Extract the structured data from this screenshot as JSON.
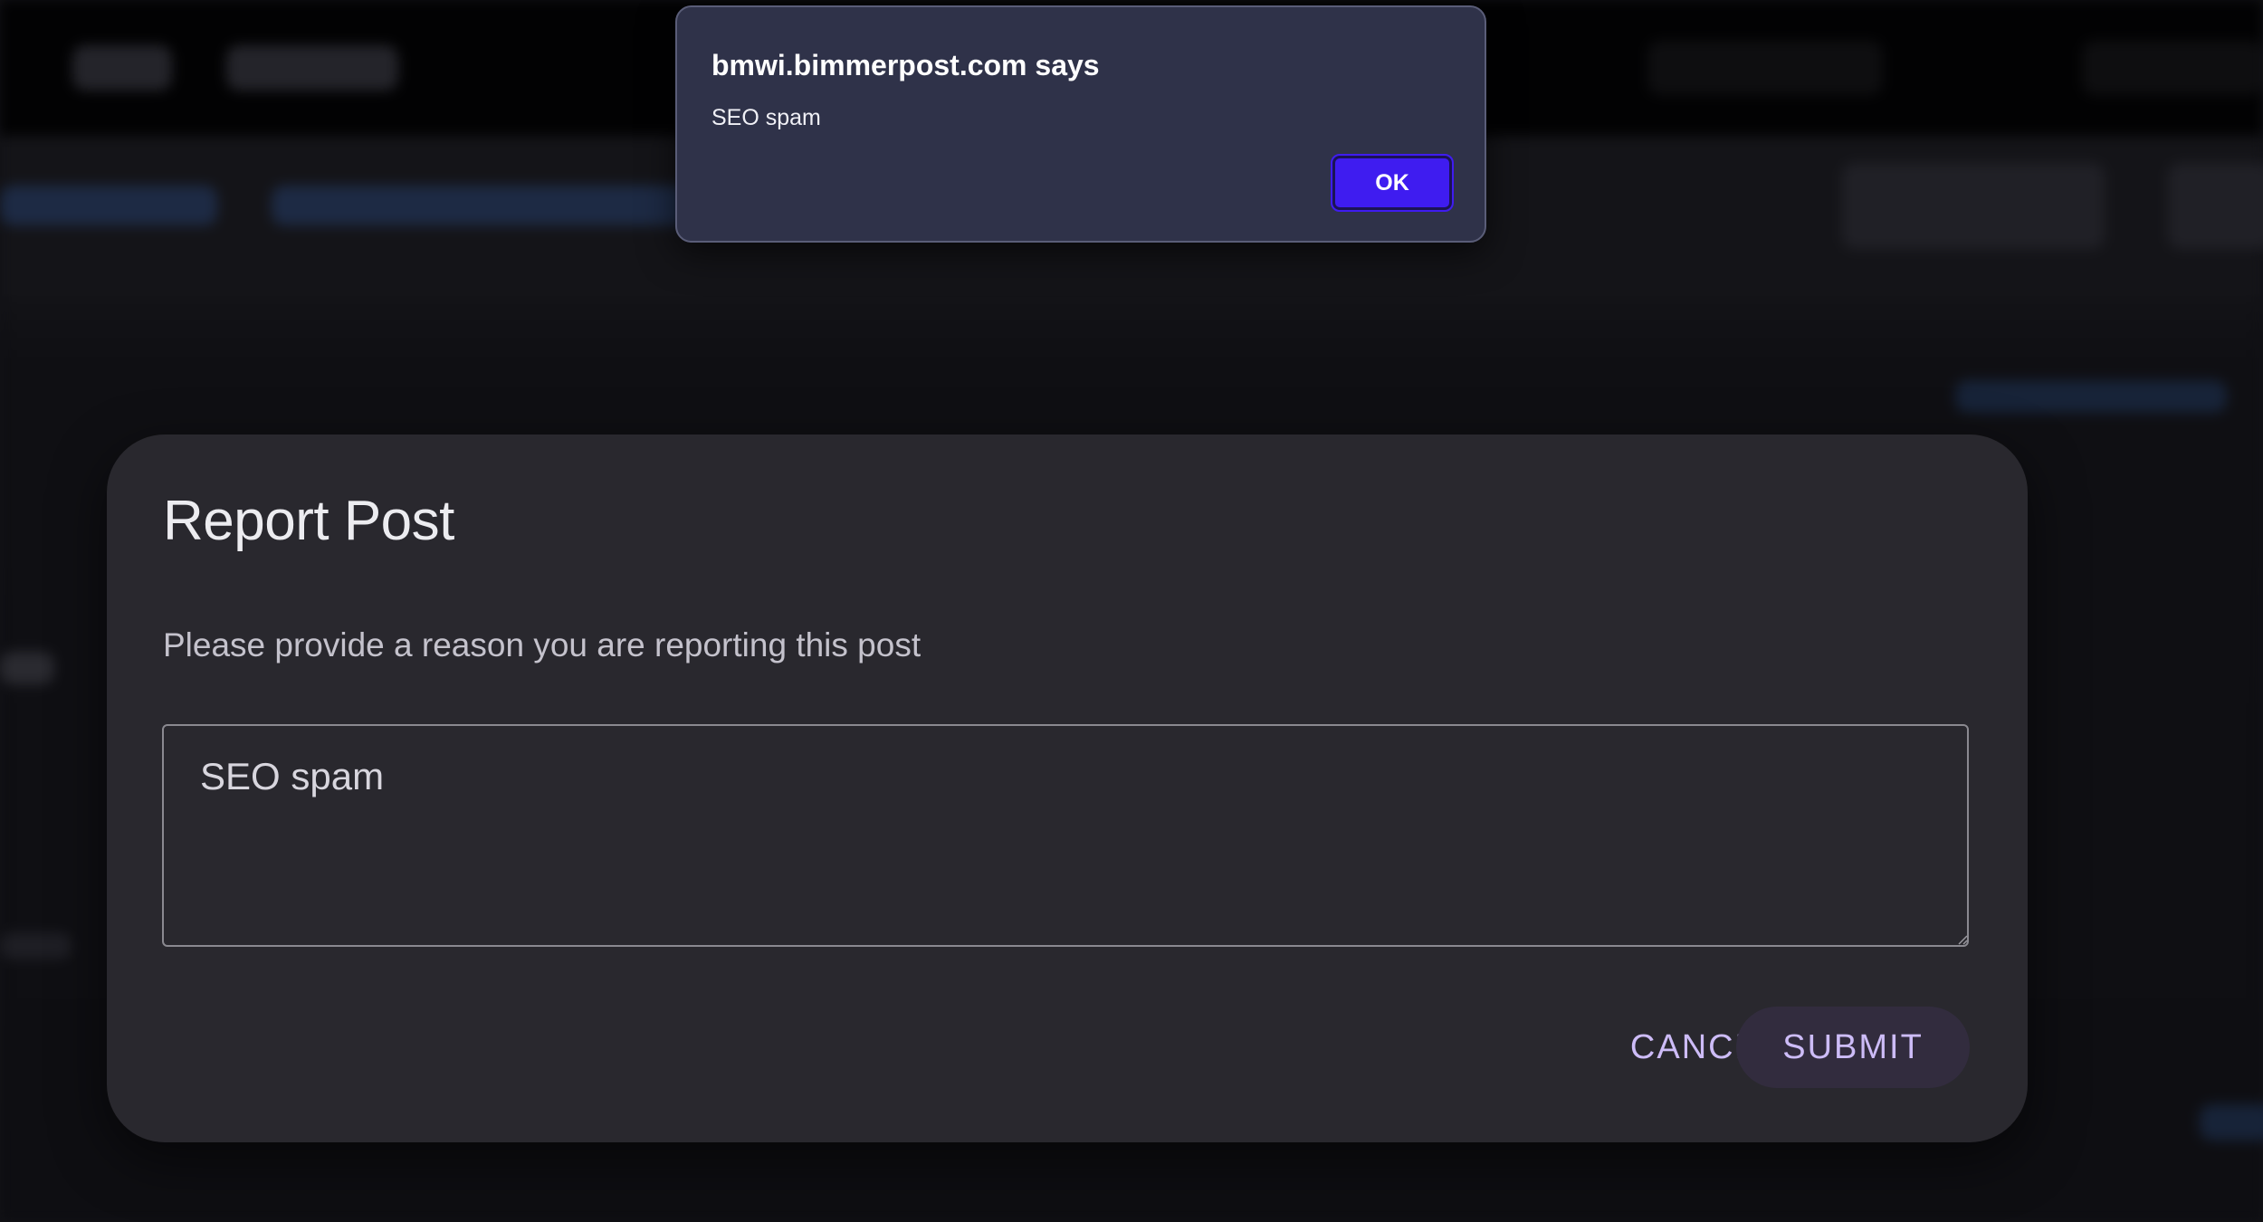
{
  "alert": {
    "title": "bmwi.bimmerpost.com says",
    "message": "SEO spam",
    "ok_label": "OK"
  },
  "report_modal": {
    "title": "Report Post",
    "description": "Please provide a reason you are reporting this post",
    "reason_value": "SEO spam",
    "cancel_label": "CANCEL",
    "submit_label": "SUBMIT"
  },
  "colors": {
    "alert_ok_button": "#3f1cf0",
    "modal_background": "#29282e",
    "button_text_accent": "#cdbcf7"
  }
}
